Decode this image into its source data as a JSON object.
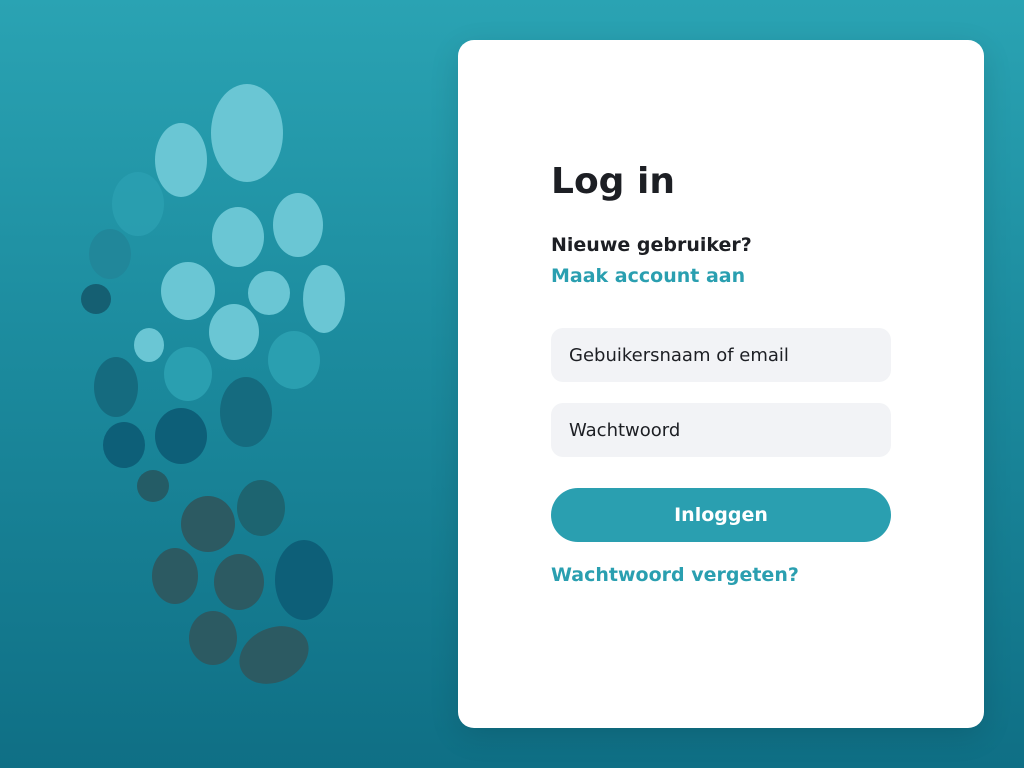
{
  "login": {
    "title": "Log in",
    "new_user_text": "Nieuwe gebruiker?",
    "create_account_link": "Maak account aan",
    "username_placeholder": "Gebuikersnaam of email",
    "password_placeholder": "Wachtwoord",
    "submit_label": "Inloggen",
    "forgot_password_link": "Wachtwoord vergeten?"
  },
  "colors": {
    "accent": "#2a9fb0",
    "background_top": "#2aa3b3",
    "background_bottom": "#0f6f85",
    "card": "#ffffff",
    "input_bg": "#f2f3f6",
    "text": "#1d1f24"
  },
  "decoration": {
    "icon": "footprint-dots-illustration"
  }
}
